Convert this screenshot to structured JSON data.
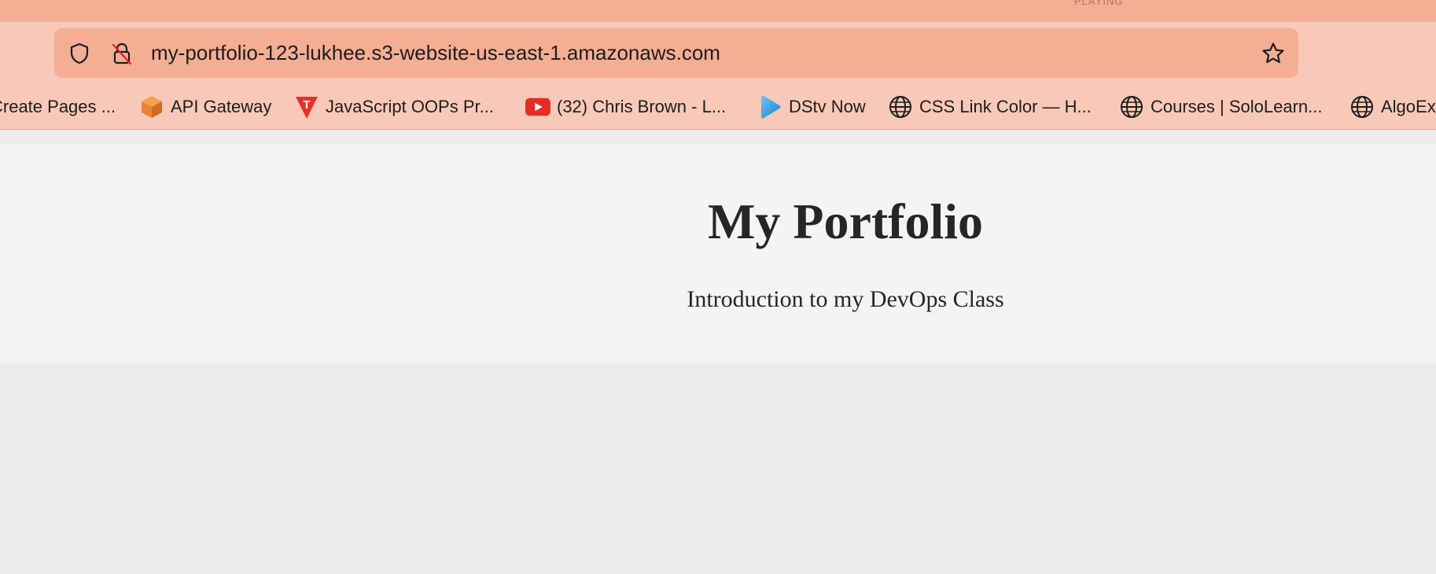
{
  "browser": {
    "tab_hint": "PLAYING",
    "address_bar": {
      "url": "my-portfolio-123-lukhee.s3-website-us-east-1.amazonaws.com",
      "icons": [
        "shield-icon",
        "insecure-lock-icon",
        "bookmark-star-icon"
      ]
    },
    "bookmarks": [
      {
        "label": "Create Pages ...",
        "icon": "none"
      },
      {
        "label": "API Gateway",
        "icon": "api-gateway-cube-icon"
      },
      {
        "label": "JavaScript OOPs Pr...",
        "icon": "t-logo-icon"
      },
      {
        "label": "(32) Chris Brown - L...",
        "icon": "youtube-icon"
      },
      {
        "label": "DStv Now",
        "icon": "play-icon"
      },
      {
        "label": "CSS Link Color — H...",
        "icon": "globe-icon"
      },
      {
        "label": "Courses | SoloLearn...",
        "icon": "globe-icon"
      },
      {
        "label": "AlgoEx",
        "icon": "globe-icon"
      }
    ]
  },
  "page": {
    "title": "My Portfolio",
    "subtitle": "Introduction to my DevOps Class"
  },
  "colors": {
    "tab_strip": "#f4ae94",
    "toolbar": "#f8c9b8",
    "url_field": "#f4ae94",
    "hero_bg": "#f4f4f4",
    "page_bg": "#ececec",
    "youtube_red": "#e52d27",
    "aws_orange": "#e8843a"
  }
}
